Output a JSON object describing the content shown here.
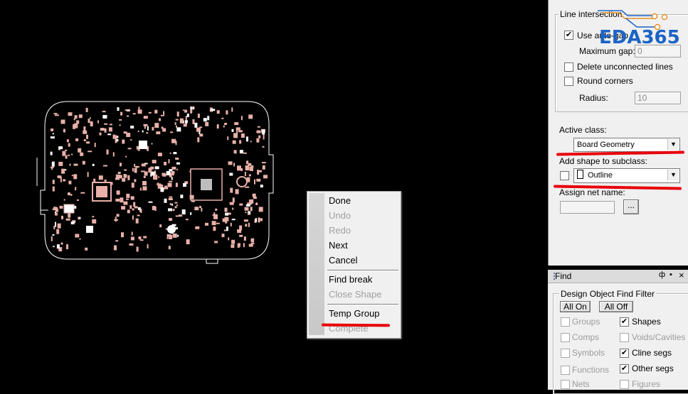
{
  "logo": {
    "text": "EDA365"
  },
  "context_menu": {
    "items": [
      {
        "label": "Done",
        "enabled": true
      },
      {
        "label": "Undo",
        "enabled": false
      },
      {
        "label": "Redo",
        "enabled": false
      },
      {
        "label": "Next",
        "enabled": true
      },
      {
        "label": "Cancel",
        "enabled": true
      },
      {
        "label": "Find break",
        "enabled": true
      },
      {
        "label": "Close Shape",
        "enabled": false
      },
      {
        "label": "Temp Group",
        "enabled": true
      },
      {
        "label": "Complete",
        "enabled": false
      }
    ]
  },
  "options": {
    "line_intersection": {
      "title": "Line intersection",
      "use_auto_gap": {
        "label": "Use auto-gap",
        "checked": true
      },
      "maximum_gap": {
        "label": "Maximum gap:",
        "value": "0"
      },
      "delete_unconnected": {
        "label": "Delete unconnected lines",
        "checked": false
      },
      "round_corners": {
        "label": "Round corners",
        "checked": false
      },
      "radius": {
        "label": "Radius:",
        "value": "10"
      }
    },
    "active_class": {
      "label": "Active class:",
      "value": "Board Geometry"
    },
    "subclass": {
      "label": "Add shape to subclass:",
      "value": "Outline",
      "checked": false
    },
    "assign_net": {
      "label": "Assign net name:",
      "value": "",
      "browse": "..."
    }
  },
  "find": {
    "title": "Find",
    "pin": "ф",
    "close": "×",
    "group_title": "Design Object Find Filter",
    "all_on": "All On",
    "all_off": "All Off",
    "left": [
      {
        "label": "Groups",
        "checked": false
      },
      {
        "label": "Comps",
        "checked": false
      },
      {
        "label": "Symbols",
        "checked": false
      },
      {
        "label": "Functions",
        "checked": false
      },
      {
        "label": "Nets",
        "checked": false
      }
    ],
    "right": [
      {
        "label": "Shapes",
        "checked": true
      },
      {
        "label": "Voids/Cavities",
        "checked": false
      },
      {
        "label": "Cline segs",
        "checked": true
      },
      {
        "label": "Other segs",
        "checked": true
      },
      {
        "label": "Figures",
        "checked": false
      }
    ]
  },
  "colors": {
    "canvas": "#000000",
    "board_outline": "#ffffff",
    "components": "#e8b0a8",
    "annotation": "#e8000a",
    "logo": "#1b63c6"
  }
}
